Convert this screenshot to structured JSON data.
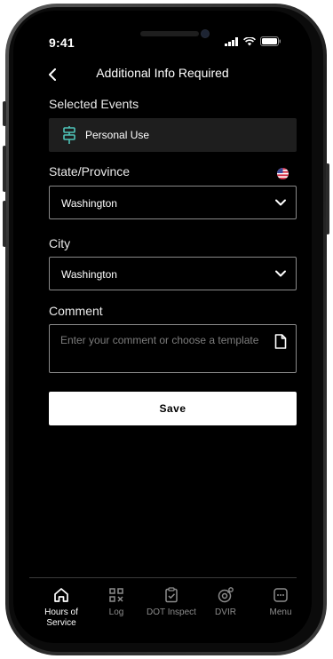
{
  "status_bar": {
    "time": "9:41"
  },
  "header": {
    "title": "Additional Info Required",
    "back_icon": "chevron-left-icon"
  },
  "selected_events": {
    "label": "Selected Events",
    "event": {
      "icon": "road-sign-icon",
      "label": "Personal Use",
      "icon_color": "#4fc3b8"
    }
  },
  "state": {
    "label": "State/Province",
    "value": "Washington",
    "flag_icon": "us-flag-icon"
  },
  "city": {
    "label": "City",
    "value": "Washington"
  },
  "comment": {
    "label": "Comment",
    "placeholder": "Enter your comment or choose a template",
    "template_icon": "document-icon"
  },
  "save_label": "Save",
  "tabs": [
    {
      "label": "Hours of Service",
      "icon": "home-icon",
      "active": true
    },
    {
      "label": "Log",
      "icon": "qr-code-icon",
      "active": false
    },
    {
      "label": "DOT Inspect",
      "icon": "clipboard-check-icon",
      "active": false
    },
    {
      "label": "DVIR",
      "icon": "tire-wrench-icon",
      "active": false
    },
    {
      "label": "Menu",
      "icon": "menu-icon",
      "active": false
    }
  ],
  "colors": {
    "background": "#000000",
    "accent": "#4fc3b8",
    "event_box": "#1e1e1e",
    "button": "#ffffff"
  }
}
